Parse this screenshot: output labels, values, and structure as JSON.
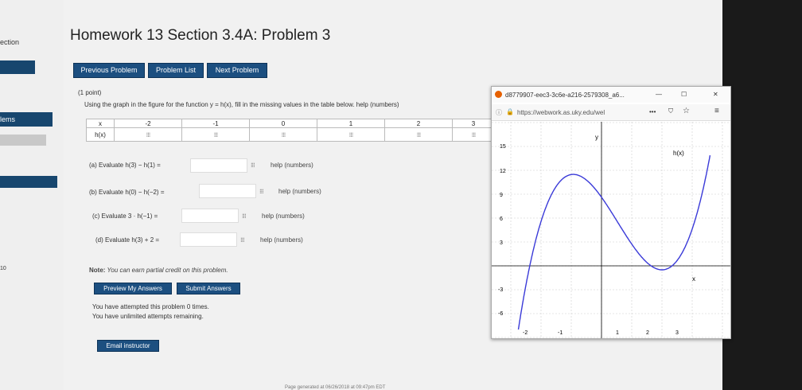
{
  "sidebar": {
    "section_label": "ection",
    "problems_label": "lems",
    "num_fragment": "10"
  },
  "header": {
    "title": "Homework 13 Section 3.4A: Problem 3"
  },
  "nav": {
    "previous": "Previous Problem",
    "list": "Problem List",
    "next": "Next Problem"
  },
  "problem": {
    "points": "(1 point)",
    "instruction": "Using the graph in the figure for the function y = h(x), fill in the missing values in the table below. help (numbers)",
    "table": {
      "header_label": "x",
      "x_values": [
        "-2",
        "-1",
        "0",
        "1",
        "2",
        "3"
      ],
      "row_label": "h(x)"
    },
    "grid_icon": "⁝⁝⁝",
    "questions": [
      {
        "label": "(a) Evaluate h(3) − h(1) =",
        "help": "help (numbers)"
      },
      {
        "label": "(b) Evaluate h(0) − h(−2) =",
        "help": "help (numbers)"
      },
      {
        "label": "(c) Evaluate 3 · h(−1) =",
        "help": "help (numbers)"
      },
      {
        "label": "(d) Evaluate h(3) + 2 =",
        "help": "help (numbers)"
      }
    ],
    "note_bold": "Note:",
    "note_text": " You can earn partial credit on this problem.",
    "preview": "Preview My Answers",
    "submit": "Submit Answers",
    "attempts_1": "You have attempted this problem 0 times.",
    "attempts_2": "You have unlimited attempts remaining.",
    "email": "Email instructor",
    "footer": "Page generated at 06/26/2018 at 09:47pm EDT"
  },
  "popup": {
    "tab_title": "d8779907-eec3-3c6e-a216-2579308_a6...",
    "min": "—",
    "max": "☐",
    "close": "✕",
    "url": "https://webwork.as.uky.edu/wel",
    "dots": "•••",
    "graph": {
      "y_axis_label": "y",
      "x_axis_label": "x",
      "curve_label": "h(x)",
      "y_ticks": [
        "15",
        "12",
        "9",
        "6",
        "3",
        "-3",
        "-6"
      ],
      "x_ticks": [
        "-2",
        "-1",
        "1",
        "2",
        "3"
      ]
    }
  }
}
